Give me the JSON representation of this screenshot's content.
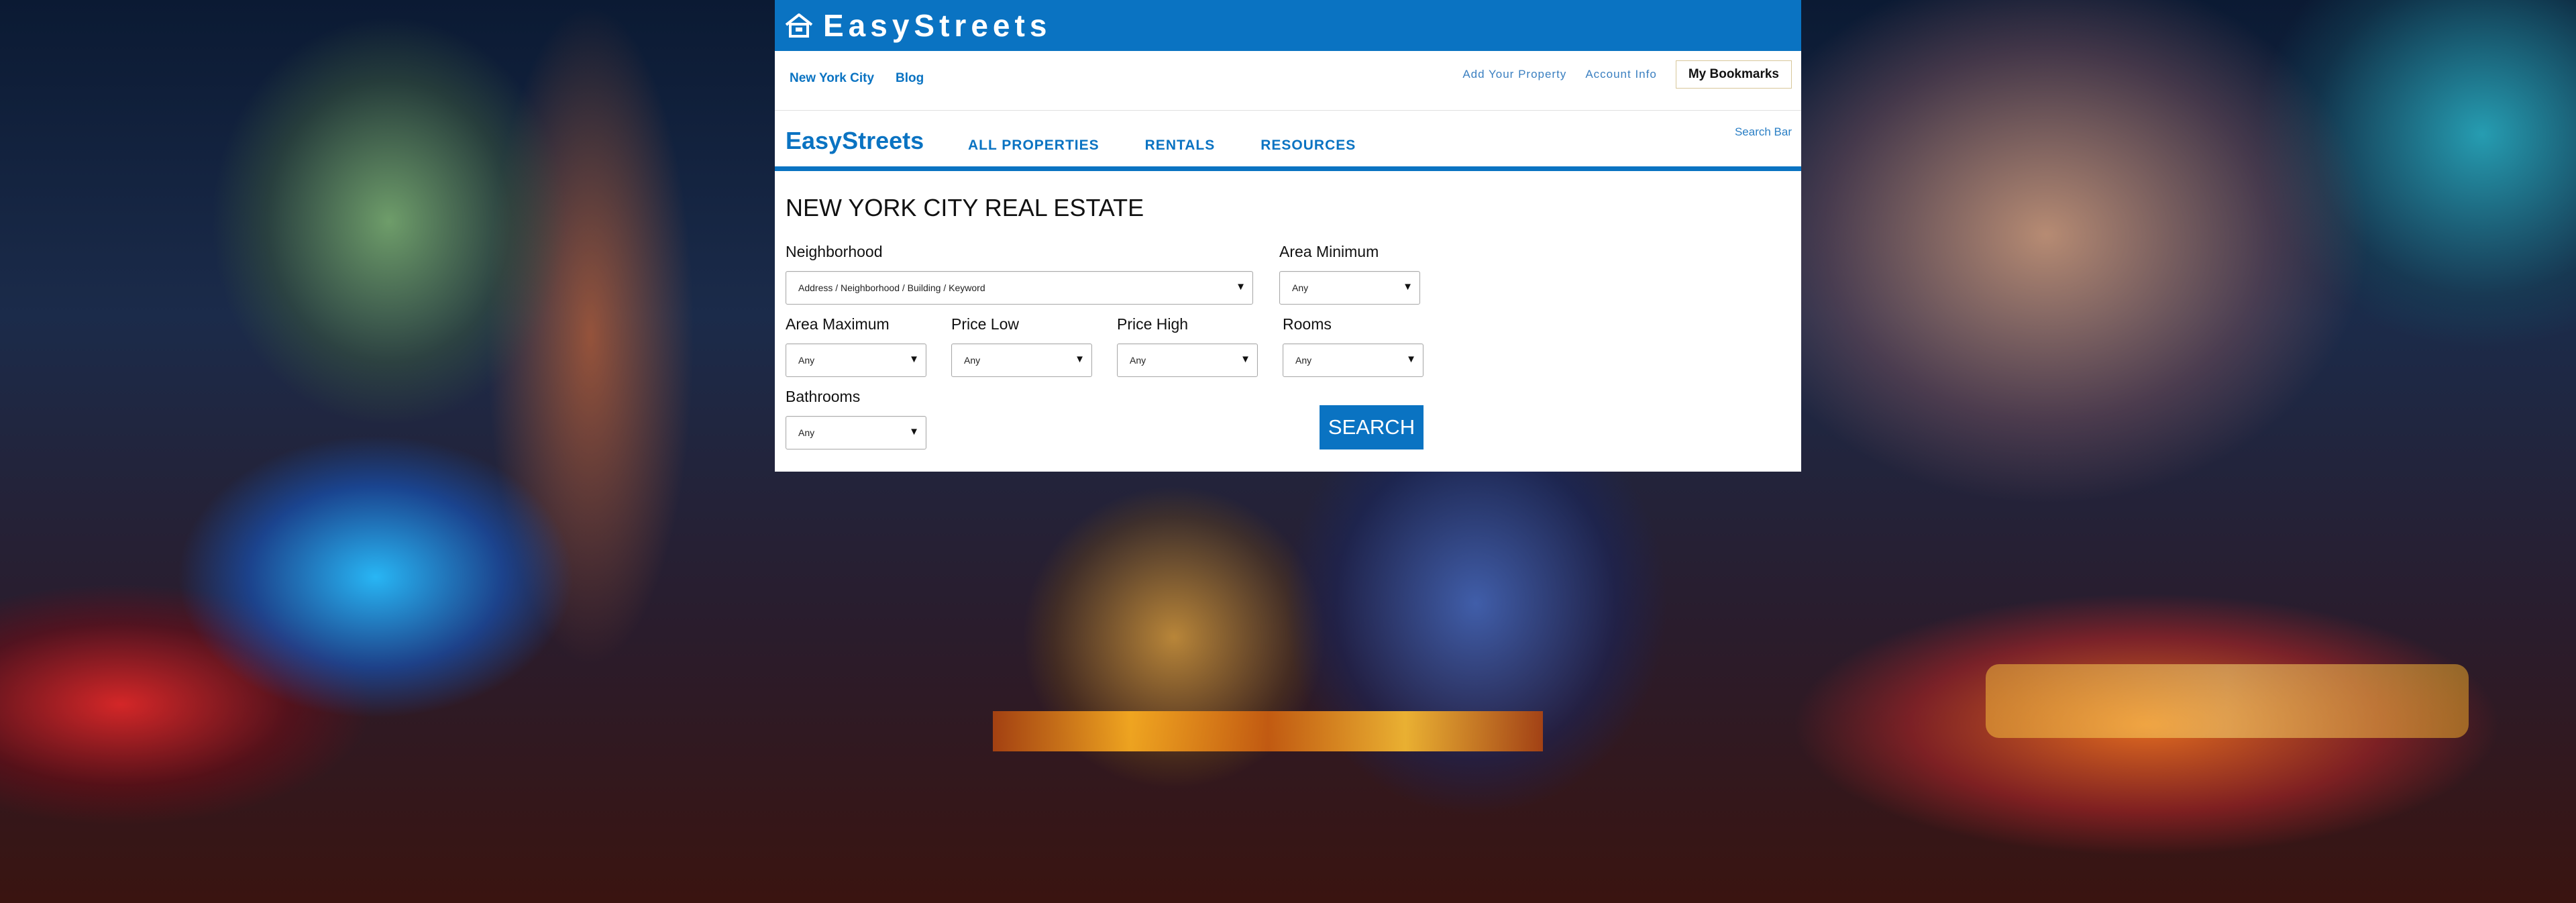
{
  "brand": {
    "logo_text": "EasyStreets",
    "logo_icon": "house-icon",
    "color": "#0a73c2"
  },
  "topnav": {
    "left_links": [
      "New York City",
      "Blog"
    ],
    "right_links": [
      "Add Your Property",
      "Account Info"
    ],
    "bookmarks_label": "My Bookmarks"
  },
  "mainnav": {
    "site_name": "EasyStreets",
    "menu": [
      "ALL PROPERTIES",
      "RENTALS",
      "RESOURCES"
    ],
    "search_link": "Search Bar"
  },
  "search_form": {
    "title": "NEW YORK CITY REAL ESTATE",
    "neighborhood": {
      "label": "Neighborhood",
      "value": "Address / Neighborhood / Building / Keyword"
    },
    "area_minimum": {
      "label": "Area Minimum",
      "value": "Any"
    },
    "area_maximum": {
      "label": "Area Maximum",
      "value": "Any"
    },
    "price_low": {
      "label": "Price Low",
      "value": "Any"
    },
    "price_high": {
      "label": "Price High",
      "value": "Any"
    },
    "rooms": {
      "label": "Rooms",
      "value": "Any"
    },
    "bathrooms": {
      "label": "Bathrooms",
      "value": "Any"
    },
    "submit_label": "SEARCH"
  },
  "background": {
    "description_icon": "times-square-photo",
    "accent_colors": [
      "#0a73c2",
      "#ffffff"
    ]
  }
}
